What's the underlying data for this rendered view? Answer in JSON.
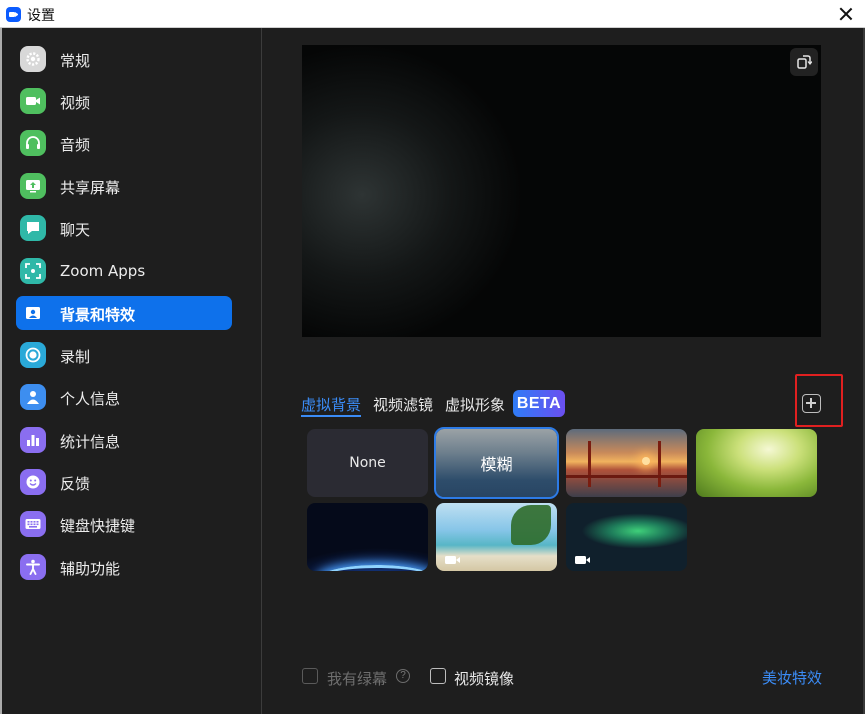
{
  "window": {
    "title": "设置"
  },
  "sidebar": {
    "items": [
      {
        "label": "常规",
        "icon": "gear-icon",
        "color": "#d8d8d8"
      },
      {
        "label": "视频",
        "icon": "video-camera-icon",
        "color": "#4fbf5f"
      },
      {
        "label": "音频",
        "icon": "headphones-icon",
        "color": "#4fbf5f"
      },
      {
        "label": "共享屏幕",
        "icon": "share-screen-icon",
        "color": "#4fbf5f"
      },
      {
        "label": "聊天",
        "icon": "chat-bubble-icon",
        "color": "#2fb8a8"
      },
      {
        "label": "Zoom Apps",
        "icon": "apps-icon",
        "color": "#2fb8a8"
      },
      {
        "label": "背景和特效",
        "icon": "background-person-icon",
        "color": "#ffffff"
      },
      {
        "label": "录制",
        "icon": "record-icon",
        "color": "#2aa9d8"
      },
      {
        "label": "个人信息",
        "icon": "person-icon",
        "color": "#3d8ef0"
      },
      {
        "label": "统计信息",
        "icon": "bar-chart-icon",
        "color": "#8a6ef0"
      },
      {
        "label": "反馈",
        "icon": "smiley-icon",
        "color": "#8a6ef0"
      },
      {
        "label": "键盘快捷键",
        "icon": "keyboard-icon",
        "color": "#8a6ef0"
      },
      {
        "label": "辅助功能",
        "icon": "accessibility-icon",
        "color": "#8a6ef0"
      }
    ],
    "active_index": 6,
    "accent": "#0e71eb"
  },
  "main": {
    "tabs": [
      {
        "label": "虚拟背景"
      },
      {
        "label": "视频滤镜"
      },
      {
        "label": "虚拟形象"
      }
    ],
    "beta_badge": "BETA",
    "add_button_icon": "plus-square-icon",
    "backgrounds": [
      {
        "label": "None",
        "kind": "none"
      },
      {
        "label": "模糊",
        "kind": "blur",
        "selected": true
      },
      {
        "label": "",
        "kind": "golden-gate-bridge"
      },
      {
        "label": "",
        "kind": "grass"
      },
      {
        "label": "",
        "kind": "earth-from-space"
      },
      {
        "label": "",
        "kind": "beach",
        "video": true
      },
      {
        "label": "",
        "kind": "aurora",
        "video": true
      }
    ],
    "options": {
      "green_screen": "我有绿幕",
      "mirror_video": "视频镜像",
      "beauty_effects": "美妆特效"
    }
  }
}
